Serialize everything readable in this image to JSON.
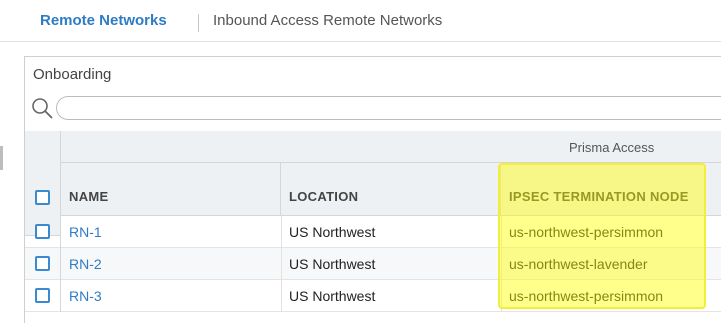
{
  "tabs": [
    {
      "label": "Remote Networks",
      "active": true
    },
    {
      "label": "Inbound Access Remote Networks",
      "active": false
    }
  ],
  "panel": {
    "title": "Onboarding",
    "search": {
      "value": "",
      "placeholder": ""
    },
    "group_header": "Prisma Access",
    "columns": [
      "NAME",
      "LOCATION",
      "IPSEC TERMINATION NODE"
    ],
    "rows": [
      {
        "name": "RN-1",
        "location": "US Northwest",
        "node": "us-northwest-persimmon"
      },
      {
        "name": "RN-2",
        "location": "US Northwest",
        "node": "us-northwest-lavender"
      },
      {
        "name": "RN-3",
        "location": "US Northwest",
        "node": "us-northwest-persimmon"
      }
    ]
  },
  "colors": {
    "accent": "#2d7cc4",
    "highlight": "#f2ee3c",
    "header_bg": "#eef1f4"
  },
  "icons": [
    "search-icon"
  ]
}
